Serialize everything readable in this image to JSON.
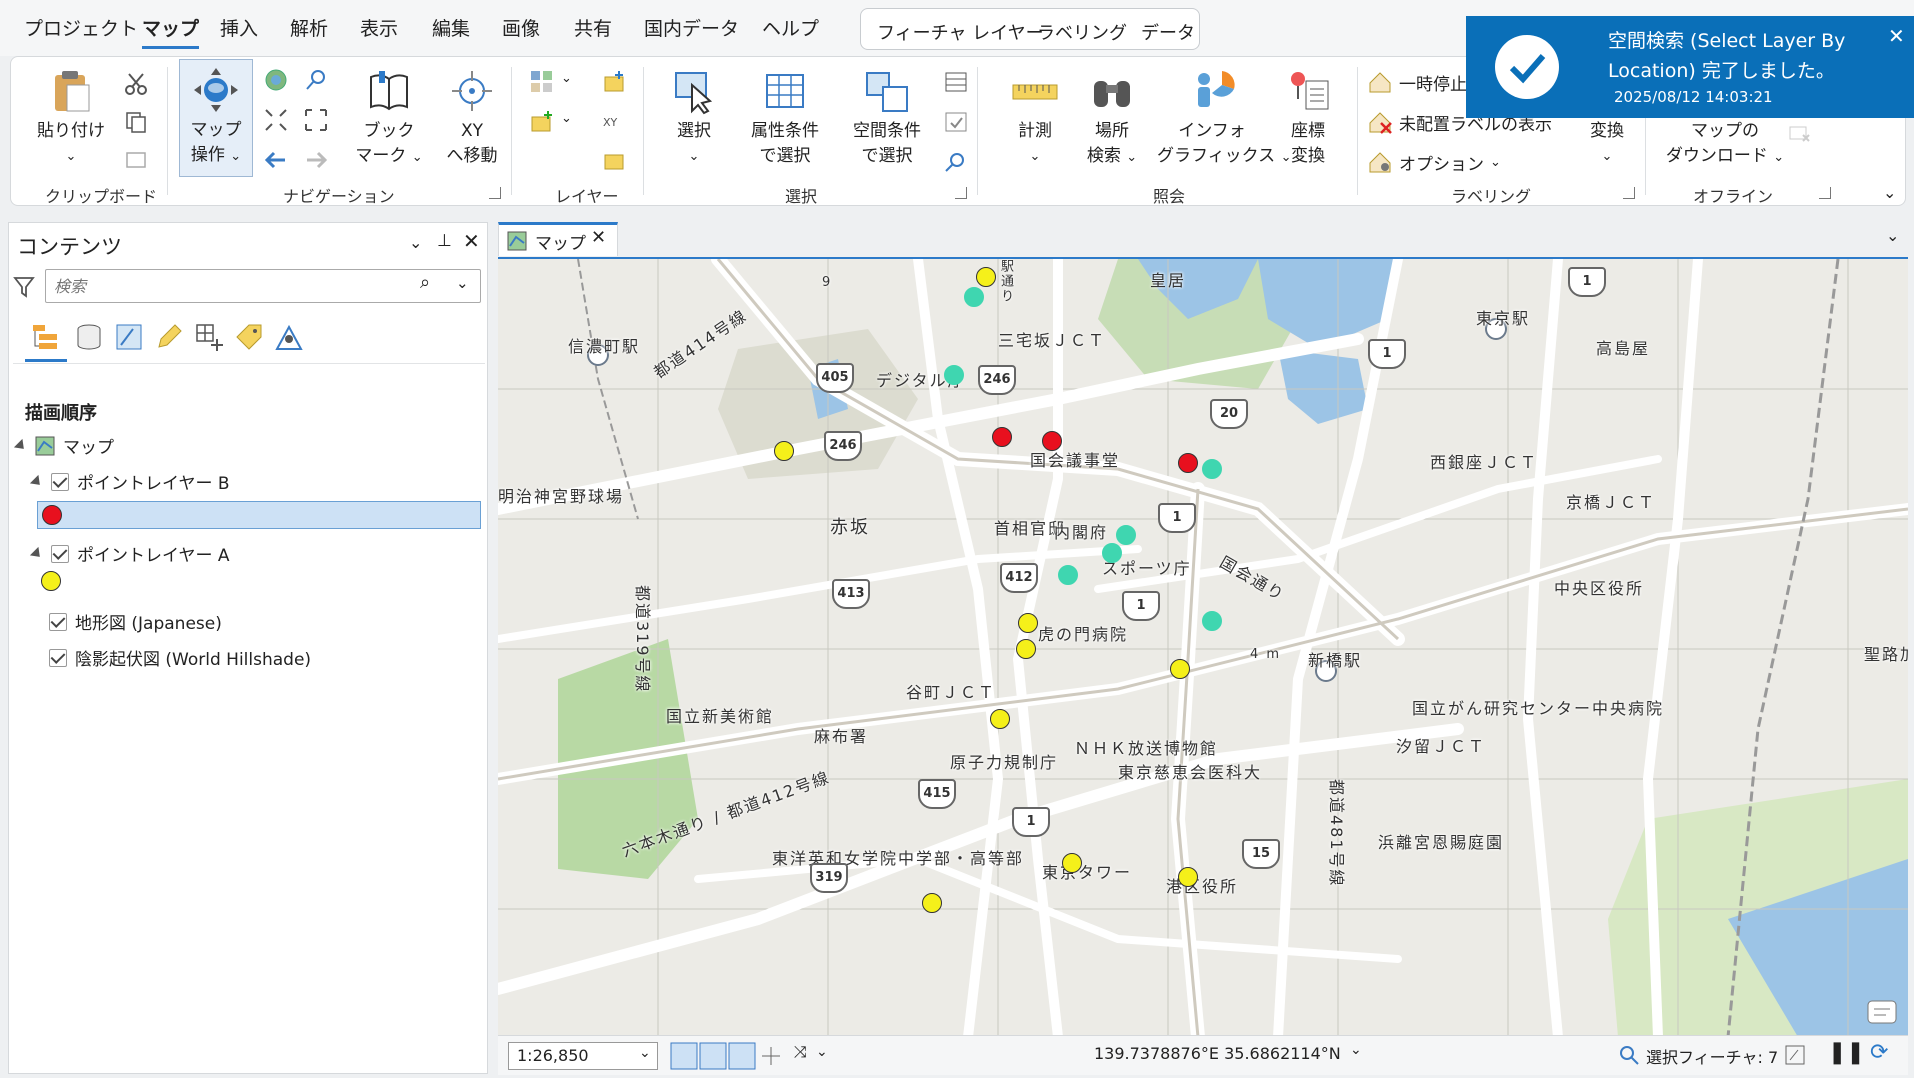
{
  "menu": {
    "items": [
      "プロジェクト",
      "マップ",
      "挿入",
      "解析",
      "表示",
      "編集",
      "画像",
      "共有",
      "国内データ",
      "ヘルプ"
    ],
    "active": "マップ",
    "context_tabs": [
      "フィーチャ レイヤー",
      "ラベリング",
      "データ"
    ]
  },
  "ribbon": {
    "clipboard": {
      "paste": "貼り付け",
      "group": "クリップボード"
    },
    "navigation": {
      "map_ops_1": "マップ",
      "map_ops_2": "操作",
      "bookmark_1": "ブック",
      "bookmark_2": "マーク",
      "xy_1": "XY",
      "xy_2": "へ移動",
      "group": "ナビゲーション"
    },
    "layer": {
      "group": "レイヤー"
    },
    "selection": {
      "select": "選択",
      "attr_1": "属性条件",
      "attr_2": "で選択",
      "spatial_1": "空間条件",
      "spatial_2": "で選択",
      "group": "選択"
    },
    "inquiry": {
      "measure": "計測",
      "locate_1": "場所",
      "locate_2": "検索",
      "info_1": "インフォ",
      "info_2": "グラフィックス",
      "coord_1": "座標",
      "coord_2": "変換",
      "group": "照会"
    },
    "labeling": {
      "pause": "一時停止",
      "unplaced": "未配置ラベルの表示",
      "options": "オプション",
      "convert": "変換",
      "group": "ラベリング"
    },
    "offline": {
      "download_1": "マップの",
      "download_2": "ダウンロード",
      "group": "オフライン"
    }
  },
  "toast": {
    "title": "空間検索 (Select Layer By Location) 完了しました。",
    "timestamp": "2025/08/12 14:03:21",
    "accent": "#0a6fb8"
  },
  "contents": {
    "title": "コンテンツ",
    "search_placeholder": "検索",
    "heading": "描画順序",
    "map": "マップ",
    "layers": [
      {
        "name": "ポイントレイヤー B",
        "checked": true,
        "symbol_color": "#e8101e"
      },
      {
        "name": "ポイントレイヤー A",
        "checked": true,
        "symbol_color": "#f5f01a"
      },
      {
        "name": "地形図 (Japanese)",
        "checked": true
      },
      {
        "name": "陰影起伏図 (World Hillshade)",
        "checked": true
      }
    ]
  },
  "map_tab": {
    "label": "マップ"
  },
  "map": {
    "labels": [
      "皇居",
      "三宅坂ＪＣＴ",
      "デジタル庁",
      "国会議事堂",
      "首相官邸",
      "内閣府",
      "赤坂",
      "スポーツ庁",
      "虎の門病院",
      "谷町ＪＣＴ",
      "国立新美術館",
      "麻布署",
      "原子力規制庁",
      "ＮＨＫ放送博物館",
      "東京慈恵会医科大",
      "東洋英和女学院中学部・高等部",
      "東京タワー",
      "港区役所",
      "信濃町駅",
      "東京駅",
      "高島屋",
      "西銀座ＪＣＴ",
      "京橋ＪＣＴ",
      "中央区役所",
      "聖路加",
      "新橋駅",
      "国立がん研究センター中央病院",
      "汐留ＪＣＴ",
      "浜離宮恩賜庭園",
      "明治神宮野球場",
      "都道414号線",
      "都道319号線",
      "六本木通り / 都道412号線",
      "都道481号線",
      "国会通り",
      "駅通り",
      "4 m",
      "9"
    ],
    "shields": [
      "405",
      "246",
      "246",
      "20",
      "1",
      "1",
      "412",
      "413",
      "1",
      "415",
      "1",
      "319",
      "15",
      "1",
      "1"
    ],
    "layer_a_count": 10,
    "layer_b_count": 3,
    "cyan_count": 6
  },
  "status": {
    "scale": "1:26,850",
    "coordinates": "139.7378876°E 35.6862114°N",
    "selected": "選択フィーチャ: 7"
  }
}
